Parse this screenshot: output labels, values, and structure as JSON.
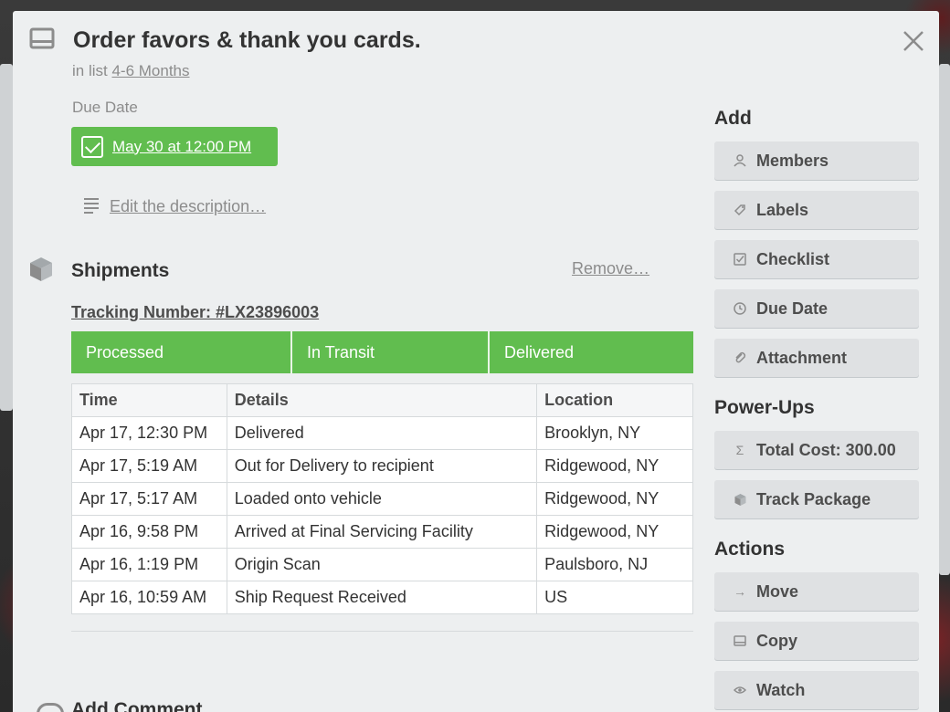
{
  "card": {
    "title": "Order favors & thank you cards.",
    "in_list_prefix": "in list",
    "list_name": "4-6 Months",
    "due_label": "Due Date",
    "due_value": "May 30 at 12:00 PM",
    "due_complete": true,
    "edit_description": "Edit the description…"
  },
  "shipments": {
    "title": "Shipments",
    "remove_label": "Remove…",
    "tracking_label": "Tracking Number: #LX23896003",
    "progress_steps": [
      "Processed",
      "In Transit",
      "Delivered"
    ],
    "columns": [
      "Time",
      "Details",
      "Location"
    ],
    "rows": [
      [
        "Apr 17, 12:30 PM",
        "Delivered",
        "Brooklyn, NY"
      ],
      [
        "Apr 17, 5:19 AM",
        "Out for Delivery to recipient",
        "Ridgewood, NY"
      ],
      [
        "Apr 17, 5:17 AM",
        "Loaded onto vehicle",
        "Ridgewood, NY"
      ],
      [
        "Apr 16, 9:58 PM",
        "Arrived at Final Servicing Facility",
        "Ridgewood, NY"
      ],
      [
        "Apr 16, 1:19 PM",
        "Origin Scan",
        "Paulsboro, NJ"
      ],
      [
        "Apr 16, 10:59 AM",
        "Ship Request Received",
        "US"
      ]
    ]
  },
  "comment": {
    "title": "Add Comment"
  },
  "sidebar": {
    "add_heading": "Add",
    "add_items": [
      {
        "label": "Members",
        "icon": "person-icon"
      },
      {
        "label": "Labels",
        "icon": "tag-icon"
      },
      {
        "label": "Checklist",
        "icon": "checklist-icon"
      },
      {
        "label": "Due Date",
        "icon": "clock-icon"
      },
      {
        "label": "Attachment",
        "icon": "paperclip-icon"
      }
    ],
    "powerups_heading": "Power-Ups",
    "powerups_items": [
      {
        "label": "Total Cost: 300.00",
        "icon": "sigma-icon"
      },
      {
        "label": "Track Package",
        "icon": "package-icon"
      }
    ],
    "actions_heading": "Actions",
    "actions_items": [
      {
        "label": "Move",
        "icon": "arrow-right-icon"
      },
      {
        "label": "Copy",
        "icon": "card-icon"
      },
      {
        "label": "Watch",
        "icon": "eye-icon"
      }
    ]
  },
  "colors": {
    "accent_green": "#61bd4f",
    "modal_bg": "#edeff0",
    "button_bg": "#dfe1e3"
  }
}
